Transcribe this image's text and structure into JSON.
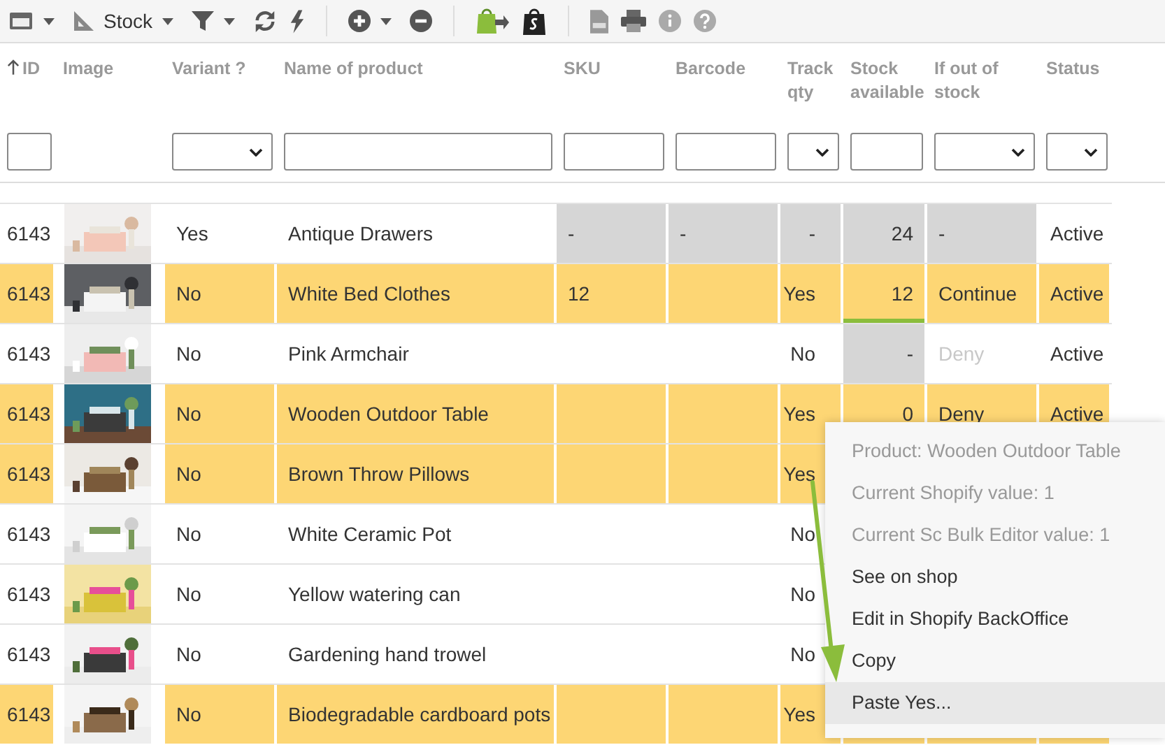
{
  "toolbar": {
    "view_label": "Stock"
  },
  "columns": [
    {
      "label": "ID",
      "sorted": true,
      "kind": "text"
    },
    {
      "label": "Image",
      "sorted": false,
      "kind": "none"
    },
    {
      "label": "Variant ?",
      "sorted": false,
      "kind": "select"
    },
    {
      "label": "Name of product",
      "sorted": false,
      "kind": "text"
    },
    {
      "label": "SKU",
      "sorted": false,
      "kind": "text"
    },
    {
      "label": "Barcode",
      "sorted": false,
      "kind": "text"
    },
    {
      "label": "Track qty",
      "sorted": false,
      "kind": "select"
    },
    {
      "label": "Stock available",
      "sorted": false,
      "kind": "text"
    },
    {
      "label": "If out of stock",
      "sorted": false,
      "kind": "select"
    },
    {
      "label": "Status",
      "sorted": false,
      "kind": "select"
    }
  ],
  "rows": [
    {
      "kind": "parent",
      "selected": false,
      "edited": false,
      "id": "6143",
      "variant": "Yes",
      "name": "Antique Drawers",
      "sku": "-",
      "barcode": "-",
      "track": "-",
      "stock": "24",
      "out_of_stock": "-",
      "status": "Active"
    },
    {
      "kind": "product",
      "selected": true,
      "tracked": true,
      "edited": true,
      "id": "6143",
      "variant": "No",
      "name": "White Bed Clothes",
      "sku": "12",
      "track": "Yes",
      "stock": "12",
      "out_of_stock": "Continue",
      "status": "Active"
    },
    {
      "kind": "product",
      "selected": false,
      "tracked": false,
      "edited": false,
      "id": "6143",
      "variant": "No",
      "name": "Pink Armchair",
      "track": "No",
      "stock": "-",
      "out_of_stock": "Deny",
      "status": "Active"
    },
    {
      "kind": "product",
      "selected": true,
      "tracked": true,
      "edited": false,
      "id": "6143",
      "variant": "No",
      "name": "Wooden Outdoor Table",
      "track": "Yes",
      "stock": "0",
      "out_of_stock": "Deny",
      "status": "Active"
    },
    {
      "kind": "product",
      "selected": true,
      "id": "6143",
      "variant": "No",
      "name": "Brown Throw Pillows",
      "track": "Yes"
    },
    {
      "kind": "product",
      "selected": false,
      "id": "6143",
      "variant": "No",
      "name": "White Ceramic Pot",
      "track": "No"
    },
    {
      "kind": "product",
      "selected": false,
      "id": "6143",
      "variant": "No",
      "name": "Yellow watering can",
      "track": "No"
    },
    {
      "kind": "product",
      "selected": false,
      "id": "6143",
      "variant": "No",
      "name": "Gardening hand trowel",
      "track": "No"
    },
    {
      "kind": "product",
      "selected": true,
      "id": "6143",
      "variant": "No",
      "name": "Biodegradable cardboard pots",
      "track": "Yes"
    }
  ],
  "context_menu": [
    {
      "label": "Product: Wooden Outdoor Table",
      "disabled": true,
      "selected": false
    },
    {
      "label": "Current Shopify value: 1",
      "disabled": true,
      "selected": false
    },
    {
      "label": "Current Sc Bulk Editor value: 1",
      "disabled": true,
      "selected": false
    },
    {
      "label": "See on shop",
      "disabled": false,
      "selected": false
    },
    {
      "label": "Edit in Shopify BackOffice",
      "disabled": false,
      "selected": false
    },
    {
      "label": "Copy",
      "disabled": false,
      "selected": false
    },
    {
      "label": "Paste Yes...",
      "disabled": false,
      "selected": true
    }
  ]
}
